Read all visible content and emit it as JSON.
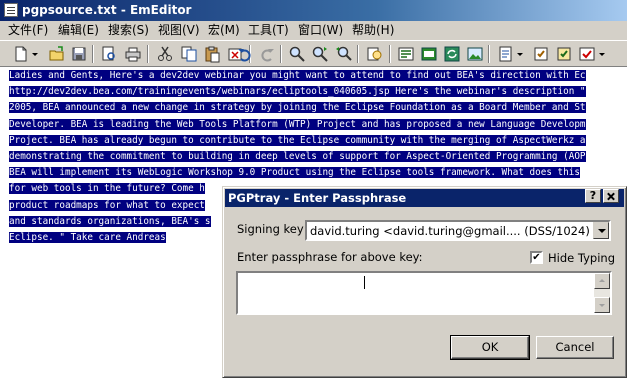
{
  "window": {
    "title": "pgpsource.txt - EmEditor"
  },
  "menu": [
    {
      "label": "文件(F)"
    },
    {
      "label": "编辑(E)"
    },
    {
      "label": "搜索(S)"
    },
    {
      "label": "视图(V)"
    },
    {
      "label": "宏(M)"
    },
    {
      "label": "工具(T)"
    },
    {
      "label": "窗口(W)"
    },
    {
      "label": "帮助(H)"
    }
  ],
  "toolbar": {
    "icons": [
      "new-file-icon",
      "open-file-icon",
      "save-icon",
      "print-preview-icon",
      "print-icon",
      "cut-icon",
      "copy-icon",
      "paste-icon",
      "delete-icon",
      "undo-icon",
      "redo-icon",
      "find-icon",
      "find-next-icon",
      "find-previous-icon",
      "highlight-icon",
      "word-wrap-icon",
      "properties-icon",
      "sync-icon",
      "image-icon",
      "macro-icon",
      "plugin-icon",
      "customize-icon"
    ]
  },
  "editor": {
    "lines": [
      "Ladies and Gents, Here's a dev2dev webinar you might want to attend to find out BEA's direction with Ec",
      "http://dev2dev.bea.com/trainingevents/webinars/ecliptools_040605.jsp Here's the webinar's description \"",
      "2005, BEA announced a new change in strategy by joining the Eclipse Foundation as a Board Member and St",
      "Developer. BEA is leading the Web Tools Platform (WTP) Project and has proposed a new Language Developm",
      "Project. BEA has already begun to contribute to the Eclipse community with the merging of AspectWerkz a",
      "demonstrating the commitment to building in deep levels of support for Aspect-Oriented Programming (AOP",
      "BEA will implement its WebLogic Workshop 9.0 Product using the Eclipse tools framework. What does this",
      "for web tools in the future? Come h",
      "product roadmaps for what to expect",
      "and standards organizations, BEA's s",
      "Eclipse. \" Take care Andreas"
    ]
  },
  "dialog": {
    "title": "PGPtray - Enter Passphrase",
    "help_button": "?",
    "signing_key_label": "Signing key :",
    "signing_key_value": "david.turing <david.turing@gmail....   (DSS/1024)",
    "passphrase_label": "Enter passphrase for above key:",
    "hide_typing_label": "Hide Typing",
    "hide_typing_checked": "✔",
    "ok_label": "OK",
    "cancel_label": "Cancel"
  }
}
